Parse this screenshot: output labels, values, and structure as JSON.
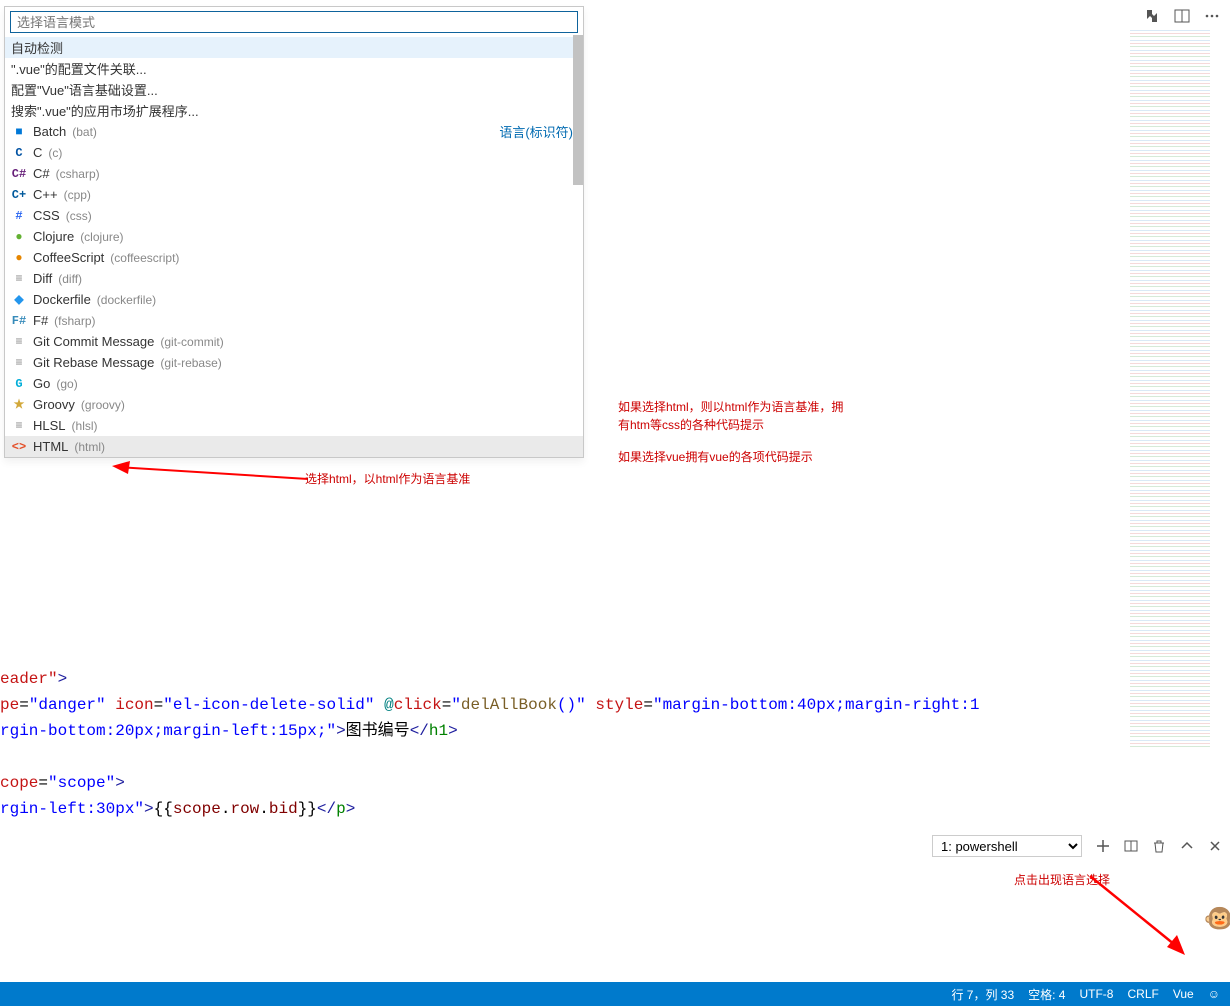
{
  "palette": {
    "placeholder": "选择语言模式",
    "options": [
      {
        "label": "自动检测",
        "selected": true
      },
      {
        "label": "\".vue\"的配置文件关联..."
      },
      {
        "label": "配置\"Vue\"语言基础设置..."
      },
      {
        "label": "搜索\".vue\"的应用市场扩展程序..."
      }
    ],
    "section_label": "语言(标识符)",
    "languages": [
      {
        "icon": "■",
        "icon_color": "#0078d7",
        "name": "Batch",
        "ext": "(bat)"
      },
      {
        "icon": "C",
        "icon_color": "#0052a3",
        "name": "C",
        "ext": "(c)"
      },
      {
        "icon": "C#",
        "icon_color": "#68217a",
        "name": "C#",
        "ext": "(csharp)"
      },
      {
        "icon": "C+",
        "icon_color": "#00599c",
        "name": "C++",
        "ext": "(cpp)"
      },
      {
        "icon": "#",
        "icon_color": "#2965f1",
        "name": "CSS",
        "ext": "(css)"
      },
      {
        "icon": "●",
        "icon_color": "#63b132",
        "name": "Clojure",
        "ext": "(clojure)"
      },
      {
        "icon": "●",
        "icon_color": "#e68600",
        "name": "CoffeeScript",
        "ext": "(coffeescript)"
      },
      {
        "icon": "≡",
        "icon_color": "#888888",
        "name": "Diff",
        "ext": "(diff)"
      },
      {
        "icon": "◆",
        "icon_color": "#2496ed",
        "name": "Dockerfile",
        "ext": "(dockerfile)"
      },
      {
        "icon": "F#",
        "icon_color": "#378bba",
        "name": "F#",
        "ext": "(fsharp)"
      },
      {
        "icon": "≡",
        "icon_color": "#888888",
        "name": "Git Commit Message",
        "ext": "(git-commit)"
      },
      {
        "icon": "≡",
        "icon_color": "#888888",
        "name": "Git Rebase Message",
        "ext": "(git-rebase)"
      },
      {
        "icon": "G",
        "icon_color": "#00add8",
        "name": "Go",
        "ext": "(go)"
      },
      {
        "icon": "★",
        "icon_color": "#d2a83a",
        "name": "Groovy",
        "ext": "(groovy)"
      },
      {
        "icon": "≡",
        "icon_color": "#888888",
        "name": "HLSL",
        "ext": "(hlsl)"
      },
      {
        "icon": "<>",
        "icon_color": "#e44d26",
        "name": "HTML",
        "ext": "(html)",
        "highlight": true
      }
    ]
  },
  "annotations": {
    "line1": "选择html，以html作为语言基准",
    "line2a": "如果选择html，则以html作为语言基准，拥",
    "line2b": "有htm等css的各种代码提示",
    "line3": "如果选择vue拥有vue的各项代码提示",
    "line4": "点击出现语言选择"
  },
  "code": {
    "l1_a": "eader\"",
    "l1_b": ">",
    "l2_a": "pe",
    "l2_b": "=",
    "l2_c": "\"danger\"",
    "l2_d": " icon",
    "l2_e": "=",
    "l2_f": "\"el-icon-delete-solid\"",
    "l2_g": " @",
    "l2_h": "click",
    "l2_i": "=",
    "l2_j": "\"",
    "l2_k": "delAllBook",
    "l2_l": "()\"",
    "l2_m": " style",
    "l2_n": "=",
    "l2_o": "\"margin-bottom:40px;margin-right:1",
    "l3_a": "rgin-bottom:20px;margin-left:15px;\"",
    "l3_b": ">",
    "l3_c": "图书编号",
    "l3_d": "</",
    "l3_e": "h1",
    "l3_f": ">",
    "l5_a": "cope",
    "l5_b": "=",
    "l5_c": "\"scope\"",
    "l5_d": ">",
    "l6_a": "rgin-left:30px\"",
    "l6_b": ">",
    "l6_c": "{{",
    "l6_d": "scope",
    "l6_e": ".",
    "l6_f": "row",
    "l6_g": ".",
    "l6_h": "bid",
    "l6_i": "}}",
    "l6_j": "</",
    "l6_k": "p",
    "l6_l": ">"
  },
  "terminal": {
    "select_label": "1: powershell"
  },
  "status": {
    "pos": "行 7，列 33",
    "spaces": "空格: 4",
    "encoding": "UTF-8",
    "eol": "CRLF",
    "language": "Vue"
  }
}
